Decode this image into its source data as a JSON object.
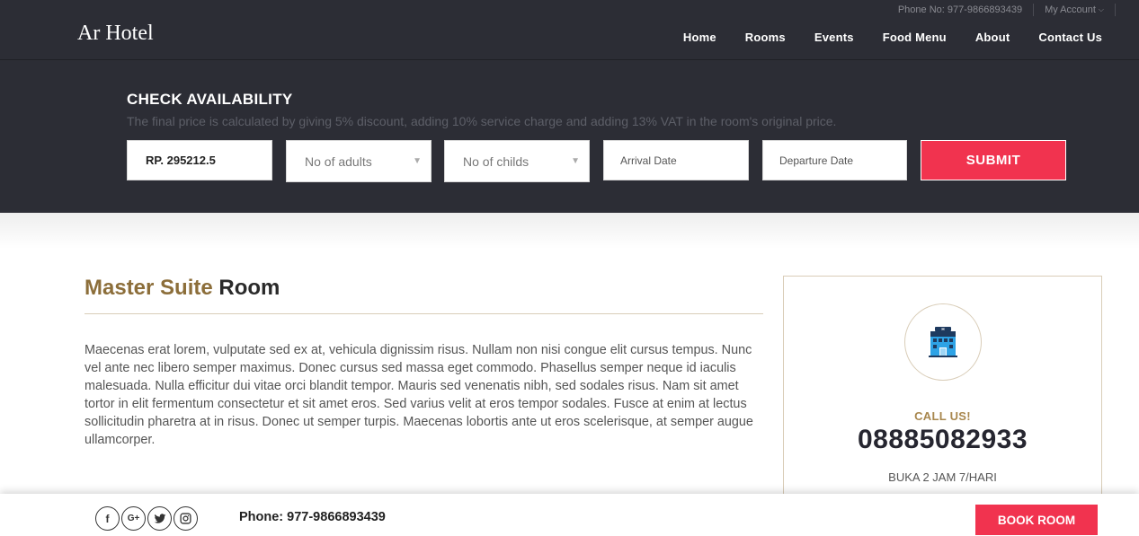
{
  "header": {
    "logo": "Ar Hotel",
    "phone": "Phone No: 977-9866893439",
    "account": "My Account",
    "nav": [
      "Home",
      "Rooms",
      "Events",
      "Food Menu",
      "About",
      "Contact Us"
    ]
  },
  "availability": {
    "title": "CHECK AVAILABILITY",
    "subtitle": "The final price is calculated by giving 5% discount, adding 10% service charge and adding 13% VAT in the room's original price.",
    "price_value": "RP. 295212.5",
    "adults_placeholder": "No of adults",
    "childs_placeholder": "No of childs",
    "arrival_placeholder": "Arrival Date",
    "departure_placeholder": "Departure Date",
    "submit_label": "SUBMIT"
  },
  "room": {
    "title_accent": "Master Suite",
    "title_rest": "Room",
    "description": "Maecenas erat lorem, vulputate sed ex at, vehicula dignissim risus. Nullam non nisi congue elit cursus tempus. Nunc vel ante nec libero semper maximus. Donec cursus sed massa eget commodo. Phasellus semper neque id iaculis malesuada. Nulla efficitur dui vitae orci blandit tempor. Mauris sed venenatis nibh, sed sodales risus. Nam sit amet tortor in elit fermentum consectetur et sit amet eros. Sed varius velit at eros tempor sodales. Fusce at enim at lectus sollicitudin pharetra at in risus. Donec ut semper turpis. Maecenas lobortis ante ut eros scelerisque, at semper augue ullamcorper."
  },
  "call_card": {
    "icon": "hotel-building-icon",
    "label": "CALL US!",
    "number": "08885082933",
    "hours": "BUKA 2 JAM 7/HARI"
  },
  "footer": {
    "social_icons": [
      "facebook-icon",
      "google-plus-icon",
      "twitter-icon",
      "instagram-icon"
    ],
    "social_glyphs": {
      "facebook": "f",
      "google": "G+"
    },
    "phone": "Phone: 977-9866893439",
    "book_label": "BOOK ROOM"
  },
  "colors": {
    "header_bg": "#2c2d35",
    "accent_red": "#f1334f",
    "gold": "#8c6e3a"
  }
}
